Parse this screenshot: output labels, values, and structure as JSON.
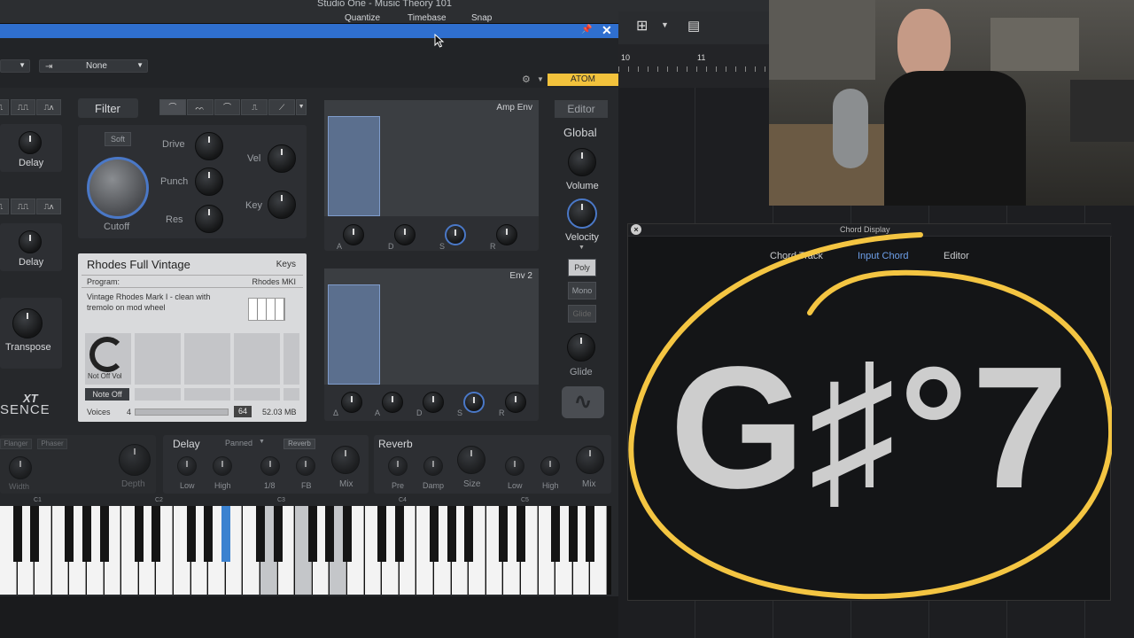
{
  "window": {
    "title": "Studio One - Music Theory 101"
  },
  "toolbar": {
    "quantize": "Quantize",
    "timebase": "Timebase",
    "snap": "Snap"
  },
  "ruler": {
    "mark_10": "10",
    "mark_11": "11"
  },
  "plugin": {
    "routing_none": "None",
    "atom_label": "ATOM",
    "left_knobs": {
      "delay1": "Delay",
      "delay2": "Delay",
      "transpose": "Transpose"
    },
    "filter": {
      "title": "Filter",
      "soft": "Soft",
      "cutoff": "Cutoff",
      "drive": "Drive",
      "punch": "Punch",
      "res": "Res",
      "vel": "Vel",
      "key": "Key"
    },
    "preset": {
      "name": "Rhodes Full Vintage",
      "category": "Keys",
      "program_label": "Program:",
      "program_value": "Rhodes MKI",
      "description": "Vintage Rhodes Mark I - clean with tremolo on mod wheel",
      "knob_label": "Not Off Vol",
      "note_off": "Note Off",
      "voices_label": "Voices",
      "voices_value": "4",
      "voices_max": "64",
      "size": "52.03 MB"
    },
    "amp_env": {
      "title": "Amp Env",
      "a": "A",
      "d": "D",
      "s": "S",
      "r": "R"
    },
    "env2": {
      "title": "Env 2",
      "delta": "Δ",
      "a": "A",
      "d": "D",
      "s": "S",
      "r": "R"
    },
    "global": {
      "editor": "Editor",
      "title": "Global",
      "volume": "Volume",
      "velocity": "Velocity",
      "poly": "Poly",
      "mono": "Mono",
      "glide_btn": "Glide",
      "glide": "Glide"
    },
    "logo": "SENCE",
    "logo_xt": "XT",
    "fx": {
      "flanger": "Flanger",
      "phaser": "Phaser",
      "width": "Width",
      "depth": "Depth",
      "delay_title": "Delay",
      "panned": "Panned",
      "reverb_btn": "Reverb",
      "low": "Low",
      "high": "High",
      "div": "1/8",
      "fb": "FB",
      "mix": "Mix",
      "reverb_title": "Reverb",
      "pre": "Pre",
      "damp": "Damp",
      "size": "Size",
      "rlow": "Low",
      "rhigh": "High",
      "rmix": "Mix"
    },
    "octaves": [
      "C1",
      "C2",
      "C3",
      "C4",
      "C5"
    ]
  },
  "chord_display": {
    "title": "Chord Display",
    "tabs": [
      "Chord Track",
      "Input Chord",
      "Editor"
    ],
    "chord": "G♯°7"
  },
  "colors": {
    "accent_blue": "#2f6fcf",
    "atom_yellow": "#f2c23c",
    "circle_yellow": "#f4c542"
  }
}
